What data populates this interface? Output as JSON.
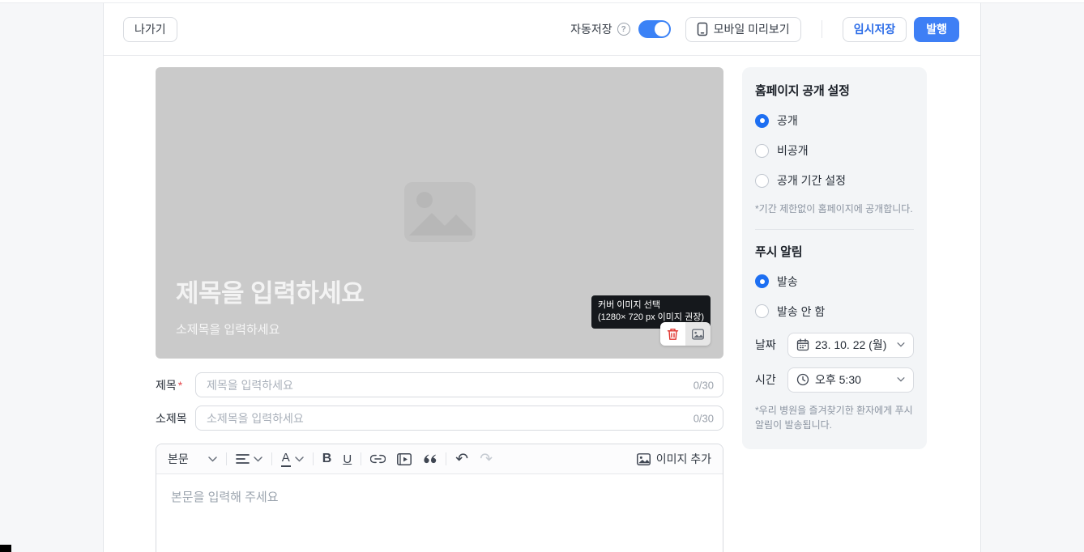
{
  "colors": {
    "accent": "#3e7ff5",
    "accent_text": "#2e6ee8",
    "danger": "#e0342f",
    "toggle_on": "#3b82f6"
  },
  "icons": {
    "undo": "↶",
    "redo": "↷",
    "help": "?"
  },
  "topbar": {
    "exit_label": "나가기",
    "autosave_label": "자동저장",
    "autosave_state": "on",
    "mobile_preview_label": "모바일 미리보기",
    "temp_save_label": "임시저장",
    "publish_label": "발행"
  },
  "cover": {
    "title_placeholder": "제목을 입력하세요",
    "subtitle_placeholder": "소제목을 입력하세요",
    "tooltip_line1": "커버 이미지 선택",
    "tooltip_line2": "(1280× 720 px 이미지 권장)"
  },
  "form": {
    "title_label": "제목",
    "required_mark": "*",
    "title_placeholder": "제목을 입력하세요",
    "title_counter": "0/30",
    "subtitle_label": "소제목",
    "subtitle_placeholder": "소제목을 입력하세요",
    "subtitle_counter": "0/30"
  },
  "editor": {
    "paragraph_style": "본문",
    "add_image_label": "이미지 추가",
    "body_placeholder": "본문을 입력해 주세요"
  },
  "sidebar": {
    "visibility": {
      "title": "홈페이지 공개 설정",
      "options": [
        {
          "label": "공개",
          "selected": true
        },
        {
          "label": "비공개",
          "selected": false
        },
        {
          "label": "공개 기간 설정",
          "selected": false
        }
      ],
      "note": "*기간 제한없이 홈페이지에 공개합니다."
    },
    "push": {
      "title": "푸시 알림",
      "options": [
        {
          "label": "발송",
          "selected": true
        },
        {
          "label": "발송 안 함",
          "selected": false
        }
      ],
      "date_label": "날짜",
      "date_value": "23. 10. 22 (월)",
      "time_label": "시간",
      "time_value": "오후 5:30",
      "note": "*우리 병원을 즐겨찾기한 환자에게 푸시 알림이 발송됩니다."
    }
  }
}
